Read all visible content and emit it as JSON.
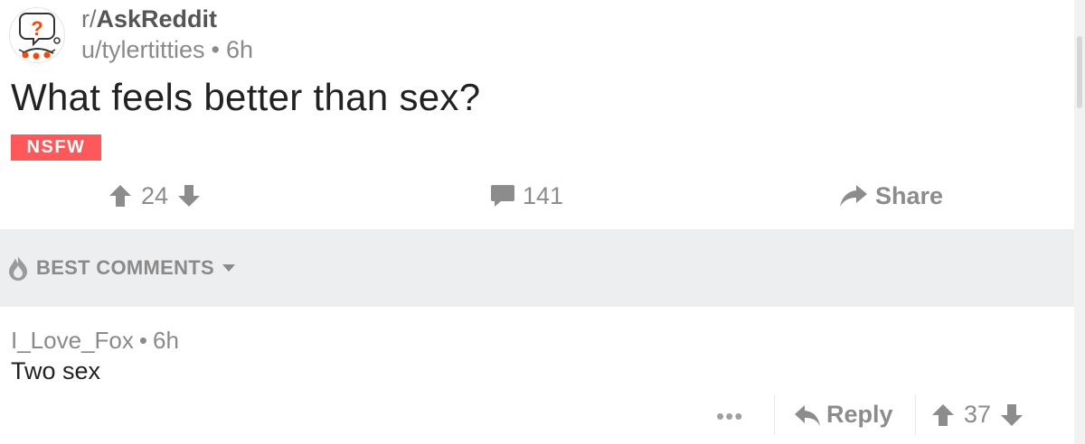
{
  "post": {
    "subreddit_prefix": "r/",
    "subreddit_name": "AskReddit",
    "author": "u/tylertitties",
    "separator": "•",
    "age": "6h",
    "title": "What feels better than sex?",
    "tag": "NSFW",
    "score": "24",
    "comment_count": "141",
    "share_label": "Share"
  },
  "sort": {
    "label": "BEST COMMENTS"
  },
  "comment": {
    "author": "I_Love_Fox",
    "separator": "•",
    "age": "6h",
    "body": "Two sex",
    "more_label": "•••",
    "reply_label": "Reply",
    "score": "37"
  },
  "colors": {
    "nsfw_badge": "#ff585b",
    "icon_gray": "#8c8c8c",
    "sort_bar_bg": "#edeef0",
    "snoo_accent": "#ff4500"
  },
  "icons": {
    "avatar": "askreddit-snoo-icon",
    "upvote": "arrow-up-icon",
    "downvote": "arrow-down-icon",
    "comments": "speech-bubble-icon",
    "share": "share-arrow-icon",
    "sort": "flame-icon",
    "reply": "reply-arrow-icon"
  }
}
